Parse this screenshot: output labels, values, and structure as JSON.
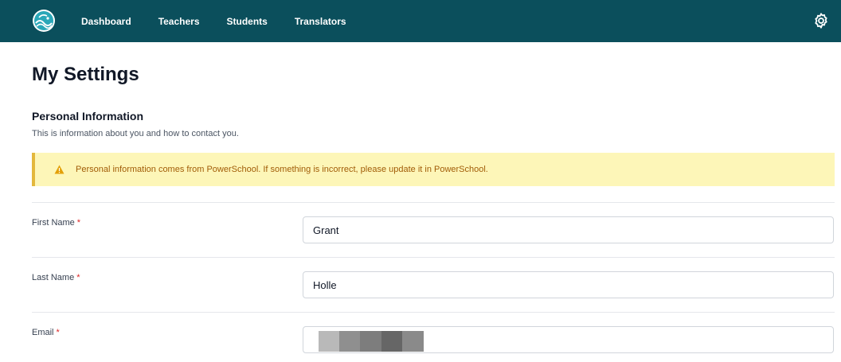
{
  "nav": {
    "items": [
      {
        "label": "Dashboard"
      },
      {
        "label": "Teachers"
      },
      {
        "label": "Students"
      },
      {
        "label": "Translators"
      }
    ],
    "icons": {
      "logo": "wave-logo-icon",
      "settings": "gear-icon"
    }
  },
  "page": {
    "title": "My Settings"
  },
  "personal_info": {
    "title": "Personal Information",
    "description": "This is information about you and how to contact you.",
    "alert": {
      "icon": "warning-icon",
      "text": "Personal information comes from PowerSchool. If something is incorrect, please update it in PowerSchool."
    },
    "fields": [
      {
        "label": "First Name",
        "required_mark": "*",
        "value": "Grant"
      },
      {
        "label": "Last Name",
        "required_mark": "*",
        "value": "Holle"
      },
      {
        "label": "Email",
        "required_mark": "*",
        "value": ""
      }
    ]
  },
  "colors": {
    "navbar": "#0b4f5c",
    "alert_bg": "#fdf6b8",
    "alert_border": "#e3b73c",
    "alert_text": "#a15c07",
    "required": "#dc2626"
  }
}
